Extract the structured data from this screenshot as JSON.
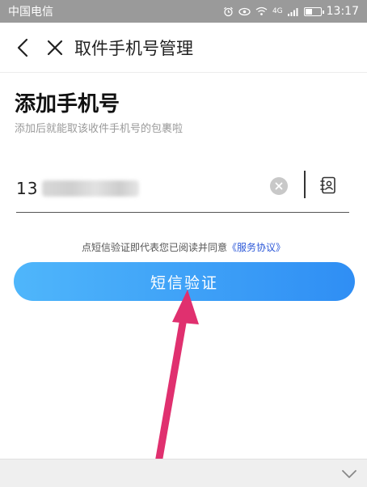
{
  "status_bar": {
    "carrier": "中国电信",
    "network_label": "4G",
    "time": "13:17"
  },
  "header": {
    "title": "取件手机号管理"
  },
  "main": {
    "heading": "添加手机号",
    "subheading": "添加后就能取该收件手机号的包裹啦",
    "phone_visible_prefix": "13",
    "agreement_text": "点短信验证即代表您已阅读并同意",
    "agreement_link": "《服务协议》",
    "verify_button_label": "短信验证"
  },
  "colors": {
    "accent": "#3a9df7",
    "link": "#2c58d8",
    "annotation_arrow": "#e0306f"
  },
  "icons": {
    "back": "chevron-left-icon",
    "close": "close-icon",
    "clear": "clear-circle-icon",
    "contacts": "contacts-book-icon",
    "collapse": "chevron-down-icon"
  }
}
